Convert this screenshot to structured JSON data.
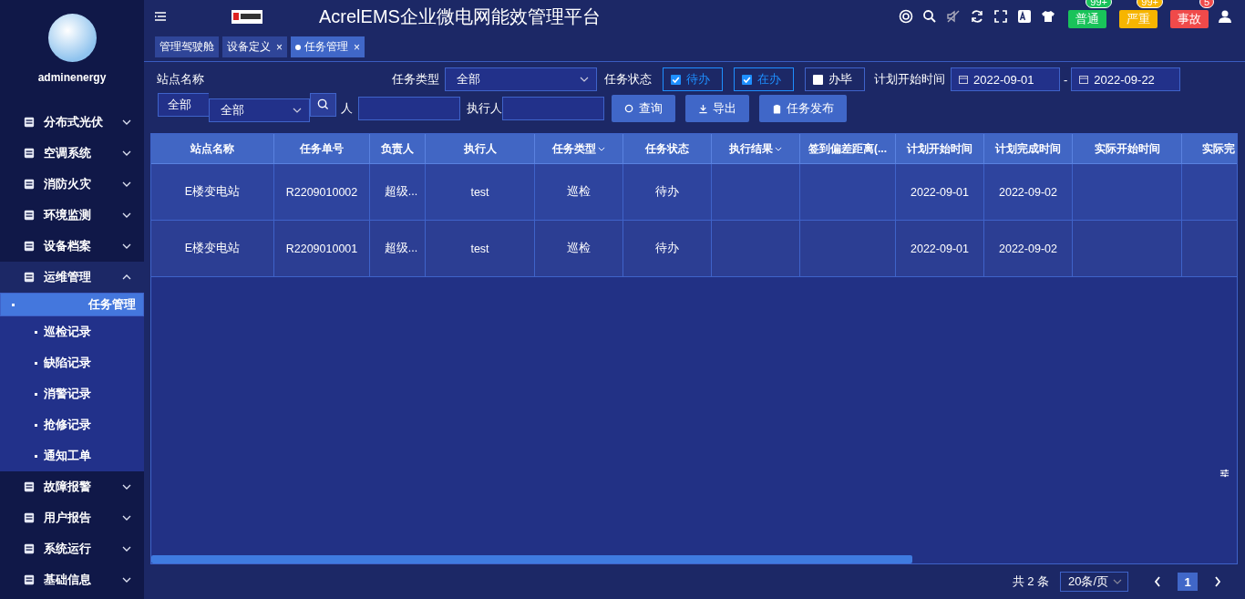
{
  "sidebar": {
    "username": "adminenergy",
    "items": [
      {
        "label": "分布式光伏",
        "expanded": false
      },
      {
        "label": "空调系统",
        "expanded": false
      },
      {
        "label": "消防火灾",
        "expanded": false
      },
      {
        "label": "环境监测",
        "expanded": false
      },
      {
        "label": "设备档案",
        "expanded": false
      },
      {
        "label": "运维管理",
        "expanded": true,
        "children": [
          {
            "label": "任务管理",
            "selected": true
          },
          {
            "label": "巡检记录",
            "selected": false
          },
          {
            "label": "缺陷记录",
            "selected": false
          },
          {
            "label": "消警记录",
            "selected": false
          },
          {
            "label": "抢修记录",
            "selected": false
          },
          {
            "label": "通知工单",
            "selected": false
          }
        ]
      },
      {
        "label": "故障报警",
        "expanded": false
      },
      {
        "label": "用户报告",
        "expanded": false
      },
      {
        "label": "系统运行",
        "expanded": false
      },
      {
        "label": "基础信息",
        "expanded": false
      }
    ]
  },
  "header": {
    "title": "AcrelEMS企业微电网能效管理平台",
    "alerts": [
      {
        "label": "普通",
        "count": "99+",
        "color": "#19c35a"
      },
      {
        "label": "严重",
        "count": "99+",
        "color": "#f7b500"
      },
      {
        "label": "事故",
        "count": "5",
        "color": "#f04a4a"
      }
    ]
  },
  "tabs": [
    {
      "label": "管理驾驶舱",
      "selected": false
    },
    {
      "label": "设备定义",
      "close": "×",
      "selected": false
    },
    {
      "label": "任务管理",
      "close": "×",
      "selected": true
    }
  ],
  "filters": {
    "station_label": "站点名称",
    "station_value": "全部",
    "station_dropdown_value": "全部",
    "owner_label": "人",
    "task_type_label": "任务类型",
    "task_type_value": "全部",
    "status_label": "任务状态",
    "statuses": [
      {
        "label": "待办",
        "checked": true
      },
      {
        "label": "在办",
        "checked": true
      },
      {
        "label": "办毕",
        "checked": false
      }
    ],
    "date_label": "计划开始时间",
    "date_from": "2022-09-01",
    "date_sep": "-",
    "date_to": "2022-09-22",
    "executor_label": "执行人",
    "buttons": [
      {
        "label": "查询",
        "kind": "search"
      },
      {
        "label": "导出",
        "kind": "export"
      },
      {
        "label": "任务发布",
        "kind": "publish"
      }
    ]
  },
  "table": {
    "columns": [
      {
        "label": "站点名称",
        "filter": false
      },
      {
        "label": "任务单号",
        "filter": false
      },
      {
        "label": "负责人",
        "filter": false
      },
      {
        "label": "执行人",
        "filter": false
      },
      {
        "label": "任务类型",
        "filter": true
      },
      {
        "label": "任务状态",
        "filter": false
      },
      {
        "label": "执行结果",
        "filter": true
      },
      {
        "label": "签到偏差距离(...",
        "filter": false
      },
      {
        "label": "计划开始时间",
        "filter": false
      },
      {
        "label": "计划完成时间",
        "filter": false
      },
      {
        "label": "实际开始时间",
        "filter": false
      },
      {
        "label": "实际完",
        "filter": false
      }
    ],
    "rows": [
      [
        "E楼变电站",
        "R2209010002",
        "超级...",
        "test",
        "巡检",
        "待办",
        "",
        "",
        "2022-09-01",
        "2022-09-02",
        "",
        ""
      ],
      [
        "E楼变电站",
        "R2209010001",
        "超级...",
        "test",
        "巡检",
        "待办",
        "",
        "",
        "2022-09-01",
        "2022-09-02",
        "",
        ""
      ]
    ]
  },
  "pagination": {
    "total": "共 2 条",
    "page_size": "20条/页",
    "pages": [
      {
        "label": "1",
        "selected": true
      }
    ]
  }
}
